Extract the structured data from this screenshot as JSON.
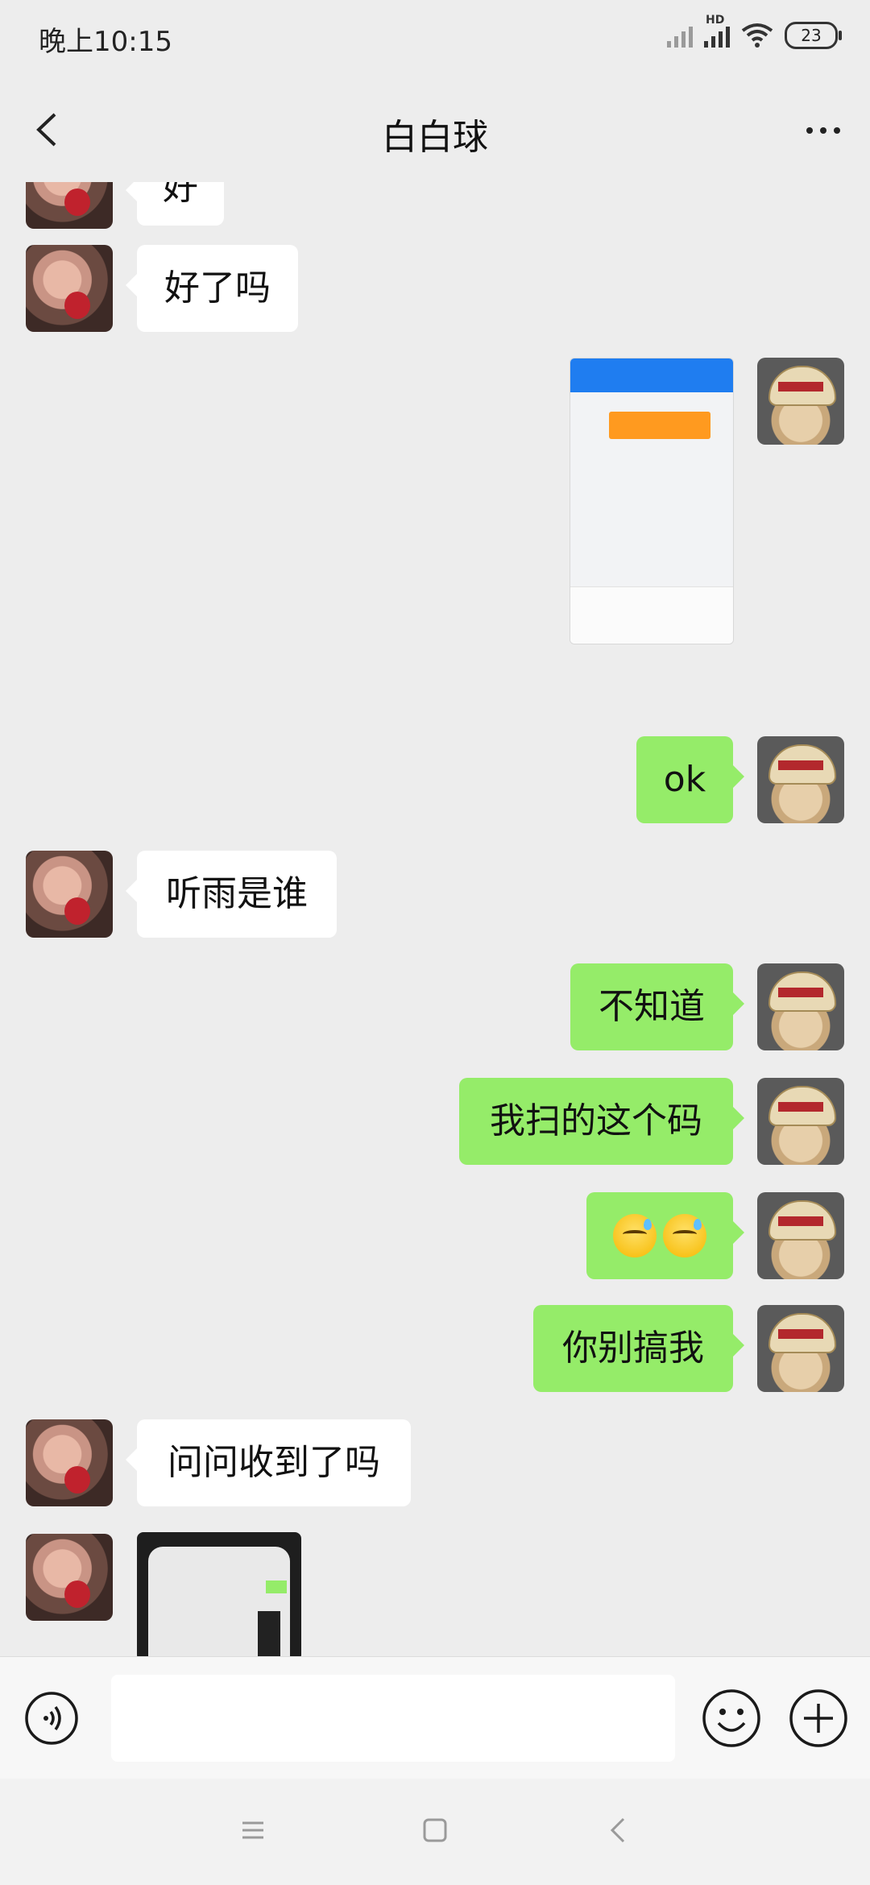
{
  "status_bar": {
    "time": "晚上10:15",
    "network_label": "HD",
    "battery": "23"
  },
  "header": {
    "title": "白白球"
  },
  "messages": [
    {
      "side": "in",
      "text": "好"
    },
    {
      "side": "in",
      "text": "好了吗"
    },
    {
      "side": "out",
      "type": "image"
    },
    {
      "side": "out",
      "text": "ok"
    },
    {
      "side": "in",
      "text": "听雨是谁"
    },
    {
      "side": "out",
      "text": "不知道"
    },
    {
      "side": "out",
      "text": "我扫的这个码"
    },
    {
      "side": "out",
      "type": "emoji"
    },
    {
      "side": "out",
      "text": "你别搞我"
    },
    {
      "side": "in",
      "text": "问问收到了吗"
    },
    {
      "side": "in",
      "type": "image"
    }
  ],
  "colors": {
    "background": "#ededed",
    "outgoing_bubble": "#95ec69",
    "incoming_bubble": "#ffffff"
  },
  "icons": {
    "back": "chevron-left-icon",
    "more": "more-dots-icon",
    "voice": "voice-input-icon",
    "emoji": "emoji-icon",
    "plus": "plus-icon",
    "nav_menu": "menu-icon",
    "nav_home": "home-square-icon",
    "nav_back": "nav-back-icon"
  }
}
